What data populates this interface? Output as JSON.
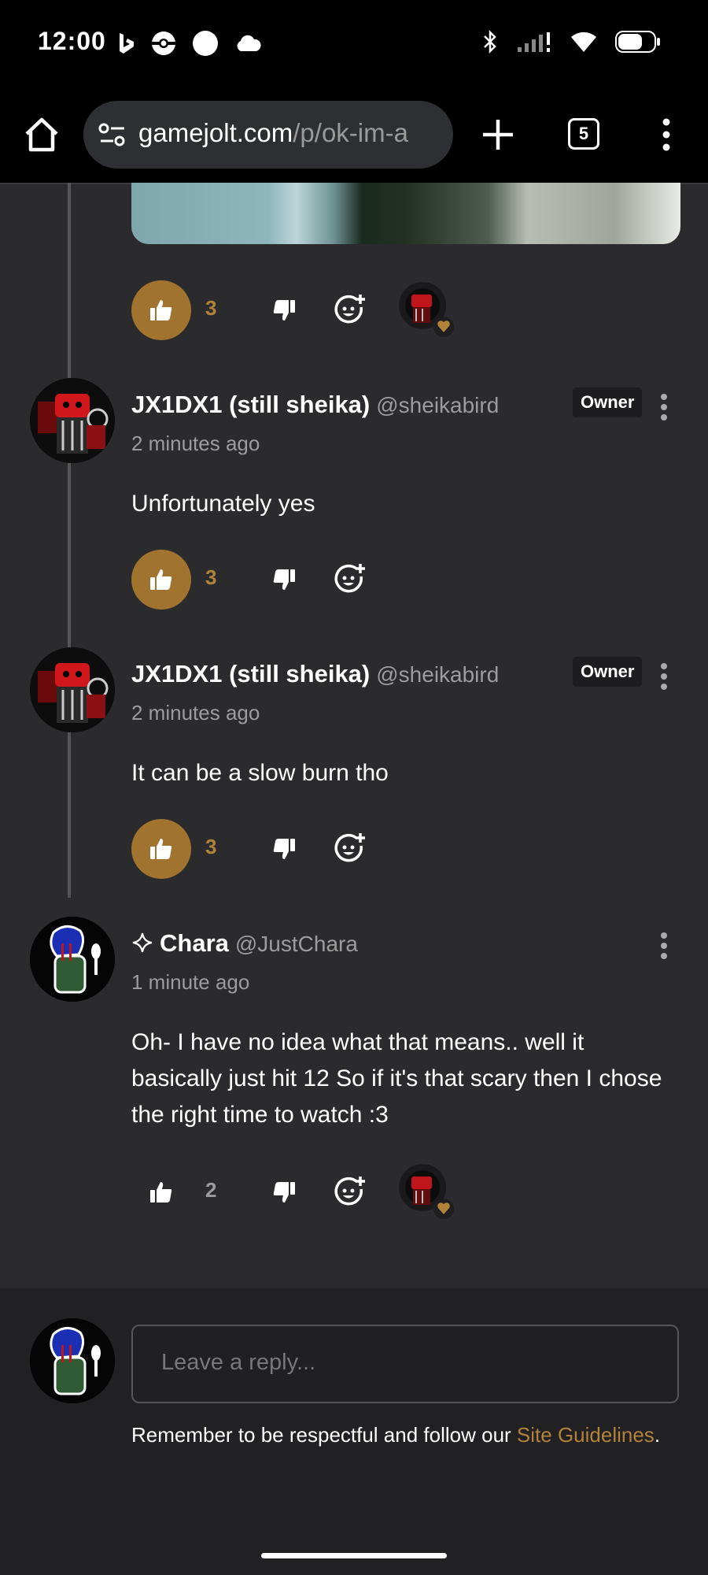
{
  "status_bar": {
    "time": "12:00",
    "left_icons": [
      "bing-icon",
      "pokeball-icon",
      "circle-icon",
      "cloud-icon"
    ],
    "right_icons": [
      "bluetooth-icon",
      "signal-icon",
      "wifi-icon",
      "battery-icon"
    ]
  },
  "browser": {
    "url_domain": "gamejolt.com",
    "url_path": "/p/ok-im-a",
    "tab_count": "5"
  },
  "top_post": {
    "like_count": "3",
    "liked": true
  },
  "comments": [
    {
      "author": "JX1DX1 (still sheika)",
      "handle": "@sheikabird",
      "badge": "Owner",
      "time": "2 minutes ago",
      "text": "Unfortunately yes",
      "like_count": "3",
      "liked": true
    },
    {
      "author": "JX1DX1 (still sheika)",
      "handle": "@sheikabird",
      "badge": "Owner",
      "time": "2 minutes ago",
      "text": "It can be a slow burn tho",
      "like_count": "3",
      "liked": true
    },
    {
      "author": "Chara",
      "handle": "@JustChara",
      "badge": "",
      "time": "1 minute ago",
      "text": "Oh- I have no idea what that means.. well it basically just hit 12 So if it's that scary then I chose the right time to watch :3",
      "like_count": "2",
      "liked": false
    }
  ],
  "reply": {
    "placeholder": "Leave a reply...",
    "note_prefix": "Remember to be respectful and follow our ",
    "note_link": "Site Guidelines",
    "note_suffix": "."
  },
  "colors": {
    "accent": "#a0732e",
    "accent_text": "#b3823a",
    "background": "#2b2b2e"
  }
}
